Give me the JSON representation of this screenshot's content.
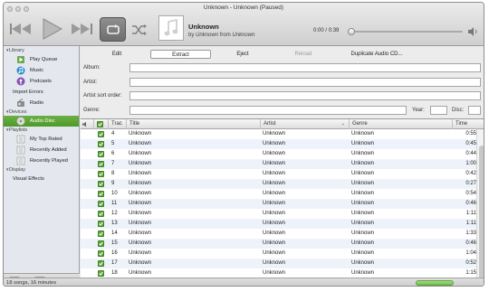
{
  "window": {
    "title": "Unknown - Unknown (Paused)"
  },
  "now_playing": {
    "title": "Unknown",
    "by_prefix": "by",
    "artist": "Unknown",
    "from_word": "from",
    "album": "Unknown",
    "elapsed": "0:00",
    "separator": "/",
    "total": "0:39",
    "progress": 0.0
  },
  "sidebar": {
    "library_header": "Library",
    "library_items": [
      {
        "label": "Play Queue",
        "icon": "play-queue-icon"
      },
      {
        "label": "Music",
        "icon": "music-note-icon"
      },
      {
        "label": "Podcasts",
        "icon": "podcast-icon"
      }
    ],
    "import_errors": "Import Errors",
    "radio": "Radio",
    "devices_header": "Devices",
    "devices_items": [
      {
        "label": "Audio Disc",
        "icon": "audio-disc-icon",
        "selected": true
      }
    ],
    "playlists_header": "Playlists",
    "playlist_items": [
      {
        "label": "My Top Rated",
        "icon": "smart-playlist-icon"
      },
      {
        "label": "Recently Added",
        "icon": "smart-playlist-icon"
      },
      {
        "label": "Recently Played",
        "icon": "smart-playlist-icon"
      }
    ],
    "display_header": "Display",
    "display_items": [
      {
        "label": "Visual Effects"
      }
    ],
    "add_symbol": "+",
    "eject_symbol": "⏏"
  },
  "content": {
    "tabs": [
      {
        "label": "Edit",
        "state": "normal"
      },
      {
        "label": "Extract",
        "state": "active"
      },
      {
        "label": "Eject",
        "state": "normal"
      },
      {
        "label": "Reload",
        "state": "disabled"
      },
      {
        "label": "Duplicate Audio CD...",
        "state": "normal"
      }
    ],
    "fields": {
      "album": "Album:",
      "artist": "Artist:",
      "artist_sort": "Artist sort order:",
      "genre": "Genre:",
      "year": "Year:",
      "disc": "Disc:"
    },
    "columns": {
      "track": "Trac",
      "title": "Title",
      "artist": "Artist",
      "genre": "Genre",
      "time": "Time"
    },
    "tracks": [
      {
        "n": "4",
        "title": "Unknown",
        "artist": "Unknown",
        "genre": "Unknown",
        "time": "0:55"
      },
      {
        "n": "5",
        "title": "Unknown",
        "artist": "Unknown",
        "genre": "Unknown",
        "time": "0:45"
      },
      {
        "n": "6",
        "title": "Unknown",
        "artist": "Unknown",
        "genre": "Unknown",
        "time": "0:44"
      },
      {
        "n": "7",
        "title": "Unknown",
        "artist": "Unknown",
        "genre": "Unknown",
        "time": "1:00"
      },
      {
        "n": "8",
        "title": "Unknown",
        "artist": "Unknown",
        "genre": "Unknown",
        "time": "0:42"
      },
      {
        "n": "9",
        "title": "Unknown",
        "artist": "Unknown",
        "genre": "Unknown",
        "time": "0:27"
      },
      {
        "n": "10",
        "title": "Unknown",
        "artist": "Unknown",
        "genre": "Unknown",
        "time": "0:54"
      },
      {
        "n": "11",
        "title": "Unknown",
        "artist": "Unknown",
        "genre": "Unknown",
        "time": "0:46"
      },
      {
        "n": "12",
        "title": "Unknown",
        "artist": "Unknown",
        "genre": "Unknown",
        "time": "1:11"
      },
      {
        "n": "13",
        "title": "Unknown",
        "artist": "Unknown",
        "genre": "Unknown",
        "time": "1:11"
      },
      {
        "n": "14",
        "title": "Unknown",
        "artist": "Unknown",
        "genre": "Unknown",
        "time": "1:33"
      },
      {
        "n": "15",
        "title": "Unknown",
        "artist": "Unknown",
        "genre": "Unknown",
        "time": "0:46"
      },
      {
        "n": "16",
        "title": "Unknown",
        "artist": "Unknown",
        "genre": "Unknown",
        "time": "1:04"
      },
      {
        "n": "17",
        "title": "Unknown",
        "artist": "Unknown",
        "genre": "Unknown",
        "time": "0:52"
      },
      {
        "n": "18",
        "title": "Unknown",
        "artist": "Unknown",
        "genre": "Unknown",
        "time": "1:15"
      }
    ]
  },
  "status": {
    "text": "18 songs, 16 minutes"
  },
  "colors": {
    "accent_green": "#5ea83b",
    "selected_row": "#4d9a2a",
    "alt_row": "#eef3fb"
  }
}
